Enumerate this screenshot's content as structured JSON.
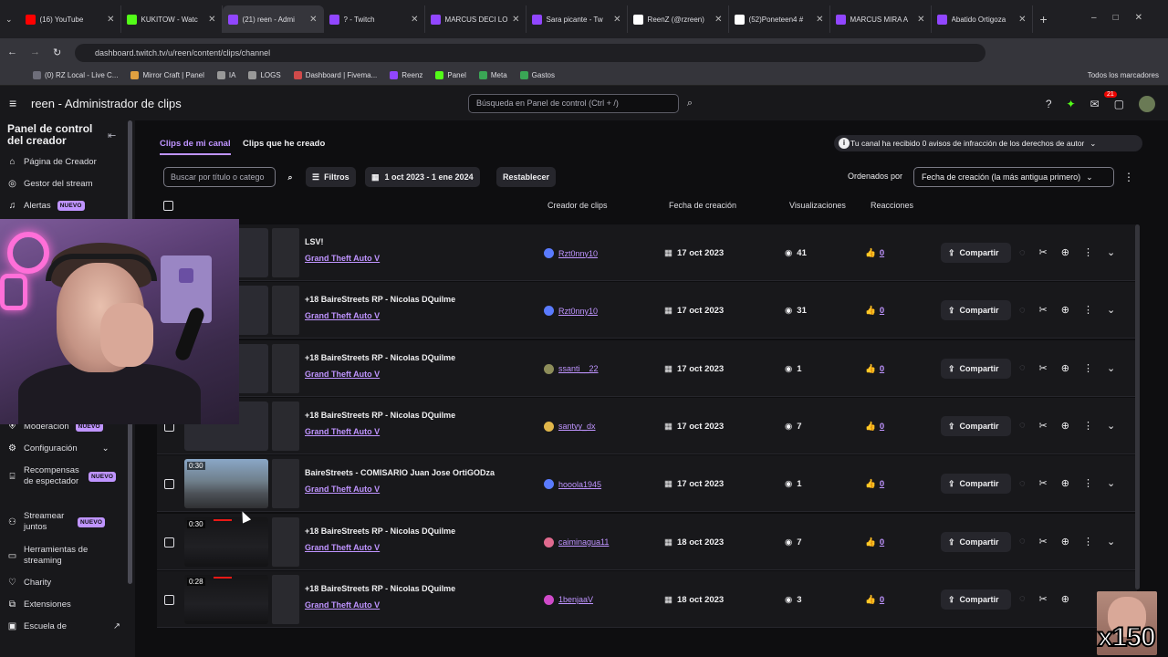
{
  "browser": {
    "tabs": [
      {
        "label": "(16) YouTube",
        "color": "#ff0000"
      },
      {
        "label": "KUKITOW - Watc",
        "color": "#53fc18"
      },
      {
        "label": "(21) reen - Admi",
        "color": "#9146ff"
      },
      {
        "label": "? - Twitch",
        "color": "#9146ff"
      },
      {
        "label": "MARCUS DECI LO",
        "color": "#9146ff"
      },
      {
        "label": "Sara picante - Tw",
        "color": "#9146ff"
      },
      {
        "label": "ReenZ (@rzreen)",
        "color": "#ffffff"
      },
      {
        "label": "(52)Poneteen4 #",
        "color": "#ffffff"
      },
      {
        "label": "MARCUS MIRA A",
        "color": "#9146ff"
      },
      {
        "label": "Abatido Ortigoza",
        "color": "#9146ff"
      }
    ],
    "url": "dashboard.twitch.tv/u/reen/content/clips/channel",
    "bookmarks": [
      "(0) RZ Local - Live C...",
      "Mirror Craft | Panel",
      "IA",
      "LOGS",
      "Dashboard | Fivema...",
      "Reenz",
      "Panel",
      "Meta",
      "Gastos"
    ],
    "bookmarks_folder": "Todos los marcadores"
  },
  "app": {
    "title": "reen - Administrador de clips",
    "search_placeholder": "Búsqueda en Panel de control (Ctrl + /)",
    "notif_count": "21"
  },
  "sidebar": {
    "title": "Panel de control del creador",
    "items": [
      {
        "label": "Página de Creador",
        "icon": "home-icon"
      },
      {
        "label": "Gestor del stream",
        "icon": "globe-icon"
      },
      {
        "label": "Alertas",
        "icon": "bell-icon",
        "badge": "NUEVO"
      },
      {
        "label": "Moderación",
        "icon": "shield-icon",
        "badge": "NUEVO"
      },
      {
        "label": "Configuración",
        "icon": "gear-icon"
      },
      {
        "label": "Recompensas de espectador",
        "icon": "gift-icon",
        "badge": "NUEVO"
      },
      {
        "label": "Streamear juntos",
        "icon": "people-icon",
        "badge": "NUEVO"
      },
      {
        "label": "Herramientas de streaming",
        "icon": "video-icon"
      },
      {
        "label": "Charity",
        "icon": "heart-icon"
      },
      {
        "label": "Extensiones",
        "icon": "puzzle-icon"
      },
      {
        "label": "Escuela de",
        "icon": "school-icon"
      }
    ]
  },
  "content": {
    "tabs": [
      "Clips de mi canal",
      "Clips que he creado"
    ],
    "notice": "Tu canal ha recibido 0 avisos de infracción de los derechos de autor",
    "filter_placeholder": "Buscar por título o catego",
    "filters_label": "Filtros",
    "date_range": "1 oct 2023 - 1 ene 2024",
    "reset_label": "Restablecer",
    "sort_label": "Ordenados por",
    "sort_value": "Fecha de creación (la más antigua primero)",
    "columns": [
      "Creador de clips",
      "Fecha de creación",
      "Visualizaciones",
      "Reacciones"
    ],
    "share_label": "Compartir",
    "clips": [
      {
        "title": "LSV!",
        "game": "Grand Theft Auto V",
        "creator": "Rzt0nny10",
        "date": "17 oct 2023",
        "views": "41",
        "reactions": "0",
        "duration": "",
        "avatar": "#5a7bff"
      },
      {
        "title": "+18 BaireStreets RP - Nicolas DQuilme",
        "game": "Grand Theft Auto V",
        "creator": "Rzt0nny10",
        "date": "17 oct 2023",
        "views": "31",
        "reactions": "0",
        "duration": "",
        "avatar": "#5a7bff"
      },
      {
        "title": "+18 BaireStreets RP - Nicolas DQuilme",
        "game": "Grand Theft Auto V",
        "creator": "ssanti__22",
        "date": "17 oct 2023",
        "views": "1",
        "reactions": "0",
        "duration": "",
        "avatar": "#8d8d5a"
      },
      {
        "title": "+18 BaireStreets RP - Nicolas DQuilme",
        "game": "Grand Theft Auto V",
        "creator": "santyy_dx",
        "date": "17 oct 2023",
        "views": "7",
        "reactions": "0",
        "duration": "",
        "avatar": "#e0b64a"
      },
      {
        "title": "BaireStreets - COMISARIO Juan Jose OrtiGODza",
        "game": "Grand Theft Auto V",
        "creator": "hooola1945",
        "date": "17 oct 2023",
        "views": "1",
        "reactions": "0",
        "duration": "0:30",
        "avatar": "#5a7bff"
      },
      {
        "title": "+18 BaireStreets RP - Nicolas DQuilme",
        "game": "Grand Theft Auto V",
        "creator": "caiminagua11",
        "date": "18 oct 2023",
        "views": "7",
        "reactions": "0",
        "duration": "0:30",
        "avatar": "#e06a8f"
      },
      {
        "title": "+18 BaireStreets RP - Nicolas DQuilme",
        "game": "Grand Theft Auto V",
        "creator": "1benjaaV",
        "date": "18 oct 2023",
        "views": "3",
        "reactions": "0",
        "duration": "0:28",
        "avatar": "#d04ac9"
      }
    ]
  },
  "overlay": {
    "multiplier": "x150"
  }
}
